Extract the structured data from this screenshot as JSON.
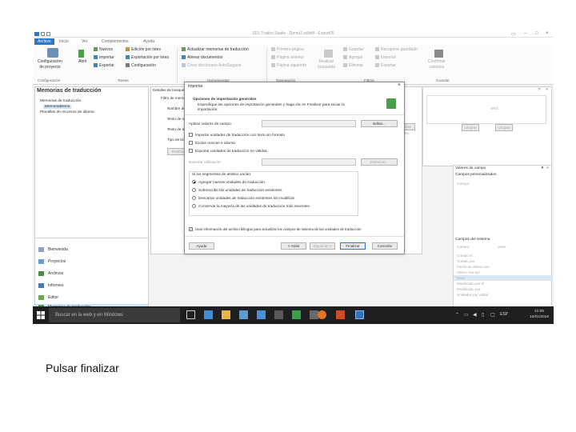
{
  "window": {
    "title": "SDL Trados Studio - Demo2.sdlxliff - Export05"
  },
  "menu_tabs": [
    "Archivo",
    "Inicio",
    "Ver",
    "Complementos",
    "Ayuda"
  ],
  "ribbon": {
    "config_label": "Configuración\nde proyecto",
    "open_label": "Abrir",
    "tasks": [
      "Nuevos",
      "Importar",
      "Exportar"
    ],
    "tasks2": [
      "Edición por lotes",
      "Exportación por lotes",
      "Configuración"
    ],
    "tools": [
      "Actualizar memorias de traducción",
      "Alinear documentos",
      "Crear diccionario AutoSuggest"
    ],
    "nav": [
      "Primera página",
      "Página anterior",
      "Página siguiente"
    ],
    "realizar": "Realizar\nbúsqueda",
    "filtros": [
      "Guardar",
      "Agregar",
      "Eliminar"
    ],
    "filtros2": [
      "Recuperar guardado",
      "Importar",
      "Exportar"
    ],
    "guardar": "Confirmar\ncambios",
    "groups": [
      "Configuración",
      "Tareas",
      "Herramientas",
      "Navegación",
      "Filtros",
      "Guardar"
    ]
  },
  "left": {
    "title": "Memorias de traducción",
    "tree": [
      "Memorias de traducción",
      "MemoriaDemo",
      "Plantillas de recursos de idioma"
    ],
    "nav": [
      "Bienvenida",
      "Proyectos",
      "Archivos",
      "Informes",
      "Editor",
      "Memorias de traducción"
    ]
  },
  "center": {
    "panel_title": "Detalles de búsqueda",
    "filter_label": "Filtro de memoria de trad",
    "fields": [
      "Nombre del filtro",
      "Texto de origen",
      "Texto de destino",
      "Tipo de búsqueda"
    ],
    "search_type_value": "Bus",
    "run_button": "Realizar búsqueda",
    "right_buttons": [
      "Aplicar filtro",
      "Limpiar",
      "Limpiar"
    ]
  },
  "right": {
    "header_value": "SRX",
    "fields_title": "Valores de campo",
    "custom_fields": "Campos personalizados",
    "field_col": "Campo",
    "system_fields": "Campos del sistema",
    "cols": [
      "Campo",
      "Valor"
    ],
    "rows": [
      "Creado el",
      "Creado por",
      "Fecha de último uso",
      "Último uso por",
      "Usos",
      "Modificado por el",
      "Modificado por",
      "Unidades por editar"
    ]
  },
  "dialog": {
    "title": "Importar",
    "heading": "Opciones de importación generales",
    "subtitle": "Especifique las opciones de importación generales y haga clic en Finalizar para iniciar la importación.",
    "field_file_label": "Aplicar valores de campo:",
    "edit_button": "Editar...",
    "check_options": [
      {
        "label": "Importar unidades de traducción con texto sin formato",
        "checked": false
      },
      {
        "label": "Excluir marcas e idioma",
        "checked": false
      },
      {
        "label": "Exportar unidades de traducción no válidas",
        "checked": false
      }
    ],
    "export_label": "Exportar utilización:",
    "export_browse": "Examinar...",
    "radio_title": "Si los segmentos de destino varían:",
    "radios": [
      {
        "label": "Agregar nuevas unidades de traducción",
        "on": true
      },
      {
        "label": "Sobrescribir las unidades de traducción existentes",
        "on": false
      },
      {
        "label": "Descartar unidades de traducción existentes sin modificar",
        "on": false
      },
      {
        "label": "Conservar la mayoría de las unidades de traducción más recientes",
        "on": false
      }
    ],
    "bottom_check": "Usar información del archivo bilingüe para actualizar los campos de sistema de las unidades de traducción",
    "buttons": {
      "help": "Ayuda",
      "back": "< Atrás",
      "next": "Siguiente >",
      "finish": "Finalizar",
      "cancel": "Cancelar"
    }
  },
  "taskbar": {
    "search_placeholder": "Buscar en la web y en Windows",
    "lang": "ESP",
    "time": "21:06",
    "date": "15/01/2016"
  },
  "caption": "Pulsar finalizar"
}
